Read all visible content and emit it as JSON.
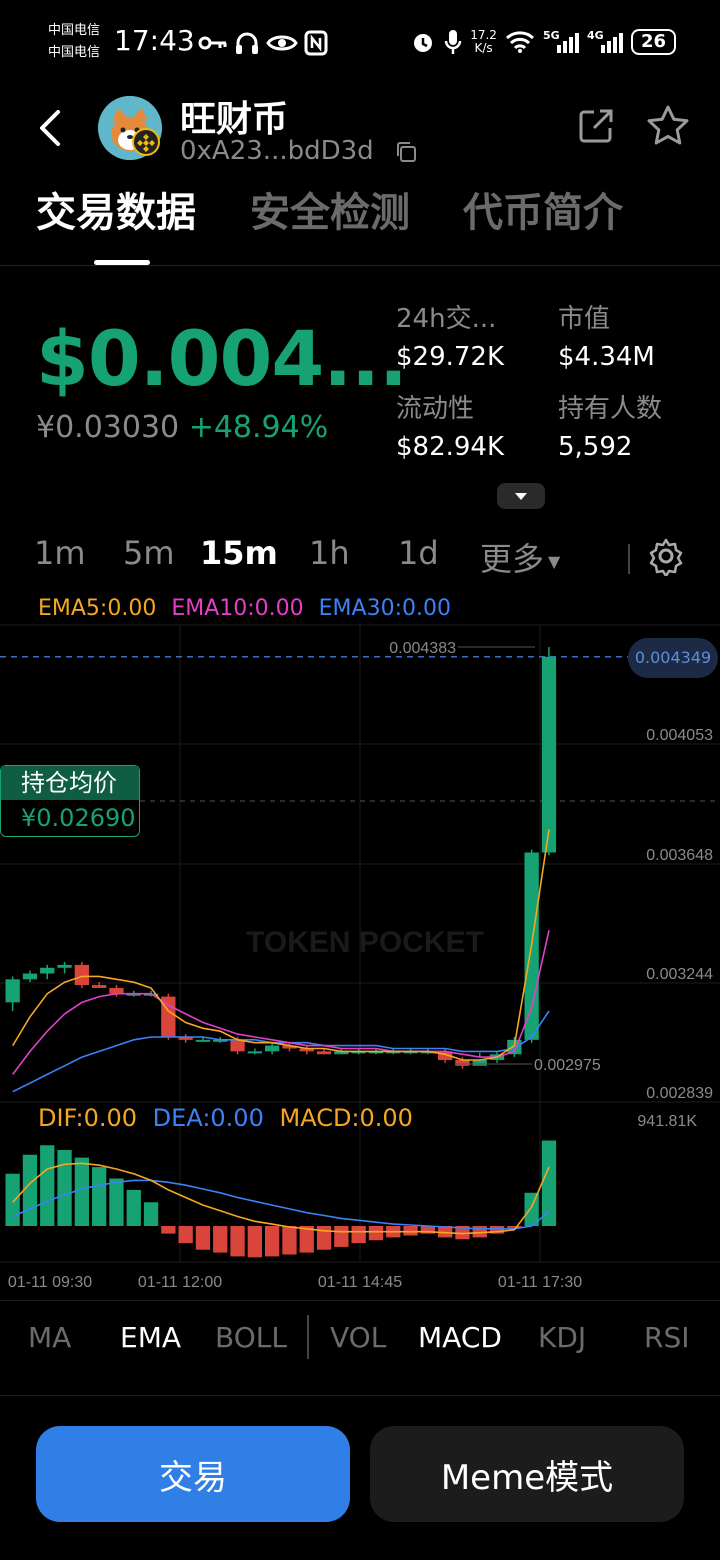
{
  "status_bar": {
    "carrier_1": "中国电信",
    "carrier_2": "中国电信",
    "time": "17:43",
    "net_speed_value": "17.2",
    "net_speed_unit": "K/s",
    "network_1": "5G",
    "network_2": "4G",
    "battery": "26"
  },
  "header": {
    "token_name": "旺财币",
    "token_address": "0xA23...bdD3d"
  },
  "tabs": [
    {
      "label": "交易数据",
      "active": true
    },
    {
      "label": "安全检测",
      "active": false
    },
    {
      "label": "代币简介",
      "active": false
    }
  ],
  "price": {
    "usd": "$0.004...",
    "cny": "¥0.03030",
    "change": "+48.94%"
  },
  "stats": {
    "volume_label": "24h交...",
    "volume_value": "$29.72K",
    "mcap_label": "市值",
    "mcap_value": "$4.34M",
    "liquidity_label": "流动性",
    "liquidity_value": "$82.94K",
    "holders_label": "持有人数",
    "holders_value": "5,592"
  },
  "timeframes": [
    {
      "label": "1m",
      "active": false
    },
    {
      "label": "5m",
      "active": false
    },
    {
      "label": "15m",
      "active": true
    },
    {
      "label": "1h",
      "active": false
    },
    {
      "label": "1d",
      "active": false
    },
    {
      "label": "更多",
      "active": false
    }
  ],
  "ema_legend": {
    "ema5": "EMA5:0.00",
    "ema10": "EMA10:0.00",
    "ema30": "EMA30:0.00"
  },
  "macd_legend": {
    "dif": "DIF:0.00",
    "dea": "DEA:0.00",
    "macd": "MACD:0.00"
  },
  "chart_overlay": {
    "hold_avg_label": "持仓均价",
    "hold_avg_value": "¥0.02690",
    "current_price_tag": "0.004349",
    "high_label": "0.004383",
    "low_label": "0.002975",
    "macd_scale": "941.81K",
    "watermark": "TOKEN POCKET"
  },
  "colors": {
    "up": "#16a273",
    "down": "#d9453a",
    "ema5": "#f5a623",
    "ema10": "#e040c8",
    "ema30": "#3b82f6",
    "accent": "#2f7fe6"
  },
  "chart_data": {
    "type": "candlestick",
    "ylim": [
      0.002839,
      0.004383
    ],
    "y_ticks": [
      "0.004053",
      "0.003648",
      "0.003244",
      "0.002839"
    ],
    "x_ticks": [
      "01-11 09:30",
      "01-11 12:00",
      "01-11 14:45",
      "01-11 17:30"
    ],
    "candles": [
      {
        "o": 0.00315,
        "h": 0.00324,
        "l": 0.00312,
        "c": 0.00323
      },
      {
        "o": 0.00323,
        "h": 0.00326,
        "l": 0.00322,
        "c": 0.00325
      },
      {
        "o": 0.00325,
        "h": 0.00328,
        "l": 0.00323,
        "c": 0.00327
      },
      {
        "o": 0.00327,
        "h": 0.00329,
        "l": 0.00325,
        "c": 0.00328
      },
      {
        "o": 0.00328,
        "h": 0.00329,
        "l": 0.0032,
        "c": 0.00321
      },
      {
        "o": 0.00321,
        "h": 0.00322,
        "l": 0.0032,
        "c": 0.0032
      },
      {
        "o": 0.0032,
        "h": 0.00321,
        "l": 0.00317,
        "c": 0.00318
      },
      {
        "o": 0.00318,
        "h": 0.00319,
        "l": 0.00317,
        "c": 0.00318
      },
      {
        "o": 0.00318,
        "h": 0.00319,
        "l": 0.00317,
        "c": 0.00318
      },
      {
        "o": 0.00317,
        "h": 0.00318,
        "l": 0.00302,
        "c": 0.00303
      },
      {
        "o": 0.00303,
        "h": 0.00304,
        "l": 0.00301,
        "c": 0.00302
      },
      {
        "o": 0.00302,
        "h": 0.00303,
        "l": 0.00302,
        "c": 0.00302
      },
      {
        "o": 0.00302,
        "h": 0.00303,
        "l": 0.00301,
        "c": 0.00302
      },
      {
        "o": 0.00302,
        "h": 0.00303,
        "l": 0.00297,
        "c": 0.00298
      },
      {
        "o": 0.00298,
        "h": 0.00299,
        "l": 0.00297,
        "c": 0.00298
      },
      {
        "o": 0.00298,
        "h": 0.00301,
        "l": 0.00297,
        "c": 0.003
      },
      {
        "o": 0.003,
        "h": 0.00301,
        "l": 0.00298,
        "c": 0.00299
      },
      {
        "o": 0.00299,
        "h": 0.003,
        "l": 0.00297,
        "c": 0.00298
      },
      {
        "o": 0.00298,
        "h": 0.00299,
        "l": 0.00297,
        "c": 0.00297
      },
      {
        "o": 0.00297,
        "h": 0.00299,
        "l": 0.00297,
        "c": 0.00298
      },
      {
        "o": 0.00298,
        "h": 0.00299,
        "l": 0.00297,
        "c": 0.00298
      },
      {
        "o": 0.00298,
        "h": 0.00299,
        "l": 0.00297,
        "c": 0.00298
      },
      {
        "o": 0.00298,
        "h": 0.00299,
        "l": 0.00297,
        "c": 0.00298
      },
      {
        "o": 0.00298,
        "h": 0.00299,
        "l": 0.00297,
        "c": 0.00298
      },
      {
        "o": 0.00298,
        "h": 0.00299,
        "l": 0.00297,
        "c": 0.00298
      },
      {
        "o": 0.00298,
        "h": 0.00299,
        "l": 0.00294,
        "c": 0.00295
      },
      {
        "o": 0.00295,
        "h": 0.00296,
        "l": 0.00292,
        "c": 0.00293
      },
      {
        "o": 0.00293,
        "h": 0.00296,
        "l": 0.002975,
        "c": 0.00295
      },
      {
        "o": 0.00295,
        "h": 0.00298,
        "l": 0.00294,
        "c": 0.00297
      },
      {
        "o": 0.00297,
        "h": 0.00303,
        "l": 0.00296,
        "c": 0.00302
      },
      {
        "o": 0.00302,
        "h": 0.00368,
        "l": 0.00301,
        "c": 0.00367
      },
      {
        "o": 0.00367,
        "h": 0.004383,
        "l": 0.00366,
        "c": 0.004349
      }
    ],
    "ema5": [
      0.003,
      0.0031,
      0.00318,
      0.00322,
      0.00324,
      0.00324,
      0.00323,
      0.00322,
      0.0032,
      0.00312,
      0.00308,
      0.00306,
      0.00305,
      0.00302,
      0.00301,
      0.00301,
      0.003,
      0.00299,
      0.00299,
      0.00298,
      0.00298,
      0.00298,
      0.00298,
      0.00298,
      0.00298,
      0.00297,
      0.00295,
      0.00295,
      0.00296,
      0.003,
      0.00335,
      0.00375
    ],
    "ema10": [
      0.0029,
      0.00298,
      0.00305,
      0.00311,
      0.00315,
      0.00317,
      0.00318,
      0.00318,
      0.00318,
      0.00314,
      0.00311,
      0.00308,
      0.00306,
      0.00304,
      0.00303,
      0.00302,
      0.00301,
      0.003,
      0.003,
      0.00299,
      0.00299,
      0.00299,
      0.00298,
      0.00298,
      0.00298,
      0.00298,
      0.00297,
      0.00296,
      0.00296,
      0.00298,
      0.00313,
      0.0034
    ],
    "ema30": [
      0.00284,
      0.00287,
      0.0029,
      0.00293,
      0.00296,
      0.00298,
      0.003,
      0.00302,
      0.00303,
      0.00303,
      0.00303,
      0.00303,
      0.00302,
      0.00302,
      0.00302,
      0.00301,
      0.00301,
      0.00301,
      0.003,
      0.003,
      0.003,
      0.003,
      0.00299,
      0.00299,
      0.00299,
      0.00299,
      0.00298,
      0.00298,
      0.00298,
      0.00299,
      0.00303,
      0.00312
    ],
    "macd_hist": [
      0.55,
      0.75,
      0.85,
      0.8,
      0.72,
      0.62,
      0.5,
      0.38,
      0.25,
      -0.08,
      -0.18,
      -0.25,
      -0.28,
      -0.32,
      -0.33,
      -0.32,
      -0.3,
      -0.28,
      -0.25,
      -0.22,
      -0.18,
      -0.15,
      -0.12,
      -0.1,
      -0.08,
      -0.12,
      -0.14,
      -0.12,
      -0.08,
      -0.02,
      0.35,
      0.9
    ],
    "dif": [
      0.25,
      0.45,
      0.6,
      0.65,
      0.66,
      0.64,
      0.6,
      0.55,
      0.48,
      0.38,
      0.3,
      0.22,
      0.16,
      0.1,
      0.05,
      0.02,
      -0.01,
      -0.03,
      -0.05,
      -0.06,
      -0.06,
      -0.06,
      -0.06,
      -0.06,
      -0.06,
      -0.07,
      -0.08,
      -0.07,
      -0.06,
      -0.04,
      0.2,
      0.62
    ],
    "dea": [
      0.1,
      0.18,
      0.26,
      0.33,
      0.39,
      0.43,
      0.46,
      0.48,
      0.48,
      0.46,
      0.43,
      0.39,
      0.35,
      0.3,
      0.26,
      0.22,
      0.18,
      0.14,
      0.11,
      0.08,
      0.06,
      0.04,
      0.02,
      0.01,
      0.0,
      -0.01,
      -0.02,
      -0.03,
      -0.03,
      -0.03,
      0.0,
      0.15
    ]
  },
  "indicators": [
    {
      "label": "MA",
      "active": false
    },
    {
      "label": "EMA",
      "active": true
    },
    {
      "label": "BOLL",
      "active": false
    },
    {
      "label": "VOL",
      "active": false
    },
    {
      "label": "MACD",
      "active": true
    },
    {
      "label": "KDJ",
      "active": false
    },
    {
      "label": "RSI",
      "active": false
    }
  ],
  "buttons": {
    "trade": "交易",
    "meme": "Meme模式"
  }
}
